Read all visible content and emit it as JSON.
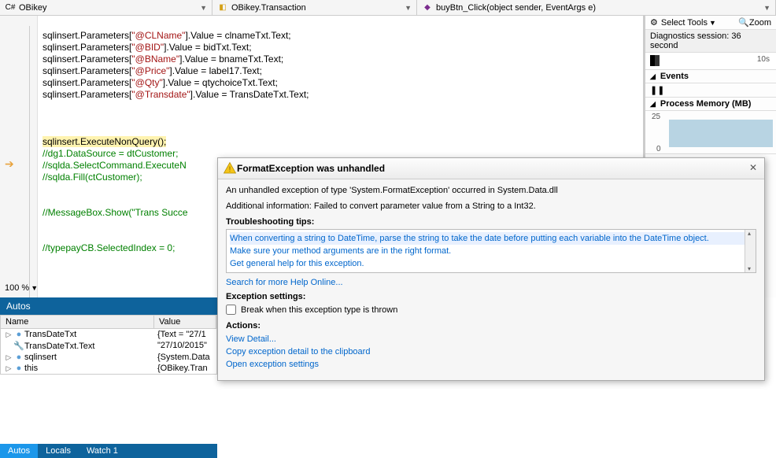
{
  "breadcrumbs": {
    "file": "OBikey",
    "file_icon": "cs-file-icon",
    "class": "OBikey.Transaction",
    "class_icon": "class-icon",
    "method": "buyBtn_Click(object sender, EventArgs e)",
    "method_icon": "method-icon"
  },
  "code_lines": {
    "l1a": "sqlinsert.Parameters[",
    "l1s": "\"@CLName\"",
    "l1b": "].Value = clnameTxt.Text;",
    "l2a": "sqlinsert.Parameters[",
    "l2s": "\"@BID\"",
    "l2b": "].Value = bidTxt.Text;",
    "l3a": "sqlinsert.Parameters[",
    "l3s": "\"@BName\"",
    "l3b": "].Value = bnameTxt.Text;",
    "l4a": "sqlinsert.Parameters[",
    "l4s": "\"@Price\"",
    "l4b": "].Value = label17.Text;",
    "l5a": "sqlinsert.Parameters[",
    "l5s": "\"@Qty\"",
    "l5b": "].Value = qtychoiceTxt.Text;",
    "l6a": "sqlinsert.Parameters[",
    "l6s": "\"@Transdate\"",
    "l6b": "].Value = TransDateTxt.Text;",
    "lhl": "sqlinsert.ExecuteNonQuery();",
    "c1": "//dg1.DataSource = dtCustomer;",
    "c2": "//sqlda.SelectCommand.ExecuteN",
    "c3": "//sqlda.Fill(ctCustomer);",
    "c4": "//MessageBox.Show(\"Trans Succe",
    "c5": "//typepayCB.SelectedIndex = 0;"
  },
  "zoom": "100 %",
  "diag": {
    "tools": "Select Tools",
    "zoom": "Zoom",
    "session": "Diagnostics session: 36 second",
    "ten": "10s",
    "events": "Events",
    "memory": "Process Memory (MB)",
    "v25": "25",
    "v0": "0"
  },
  "autos": {
    "title": "Autos",
    "col_name": "Name",
    "col_value": "Value",
    "rows": [
      {
        "icon": "●",
        "name": "TransDateTxt",
        "value": "{Text = \"27/1"
      },
      {
        "icon": "🔧",
        "name": "TransDateTxt.Text",
        "value": "\"27/10/2015\""
      },
      {
        "icon": "●",
        "name": "sqlinsert",
        "value": "{System.Data"
      },
      {
        "icon": "●",
        "name": "this",
        "value": "{OBikey.Tran"
      }
    ],
    "tabs": {
      "autos": "Autos",
      "locals": "Locals",
      "watch": "Watch 1"
    }
  },
  "popup": {
    "title": "FormatException was unhandled",
    "msg1": "An unhandled exception of type 'System.FormatException' occurred in System.Data.dll",
    "msg2": "Additional information: Failed to convert parameter value from a String to a Int32.",
    "tips_hdr": "Troubleshooting tips:",
    "tip1": "When converting a string to DateTime, parse the string to take the date before putting each variable into the DateTime object.",
    "tip2": "Make sure your method arguments are in the right format.",
    "tip3": "Get general help for this exception.",
    "search": "Search for more Help Online...",
    "settings_hdr": "Exception settings:",
    "chk": "Break when this exception type is thrown",
    "actions_hdr": "Actions:",
    "a1": "View Detail...",
    "a2": "Copy exception detail to the clipboard",
    "a3": "Open exception settings"
  }
}
